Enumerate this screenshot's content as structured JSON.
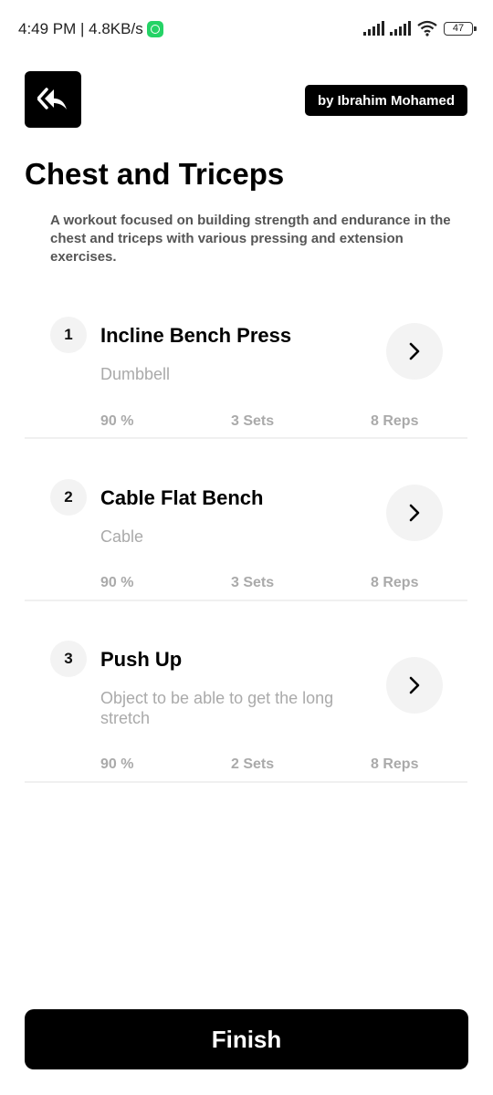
{
  "status": {
    "time_speed": "4:49 PM | 4.8KB/s",
    "battery": "47"
  },
  "header": {
    "author": "by Ibrahim Mohamed"
  },
  "workout": {
    "title": "Chest and Triceps",
    "description": "A workout focused on building strength and endurance in the chest and triceps with various pressing and extension exercises."
  },
  "exercises": [
    {
      "number": "1",
      "name": "Incline Bench Press",
      "equipment": "Dumbbell",
      "intensity": "90 %",
      "sets": "3 Sets",
      "reps": "8 Reps"
    },
    {
      "number": "2",
      "name": "Cable Flat Bench",
      "equipment": "Cable",
      "intensity": "90 %",
      "sets": "3 Sets",
      "reps": "8 Reps"
    },
    {
      "number": "3",
      "name": "Push Up",
      "equipment": "Object to be able to get the long stretch",
      "intensity": "90 %",
      "sets": "2 Sets",
      "reps": "8 Reps"
    }
  ],
  "footer": {
    "finish_label": "Finish"
  }
}
